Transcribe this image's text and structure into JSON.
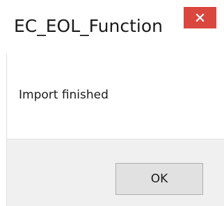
{
  "dialog": {
    "title": "EC_EOL_Function",
    "message": "Import finished",
    "ok_label": "OK",
    "close_icon": "close-icon"
  },
  "colors": {
    "close_button_bg": "#d9473f",
    "button_bar_bg": "#f0f0f0",
    "ok_button_bg": "#e1e1e1"
  }
}
